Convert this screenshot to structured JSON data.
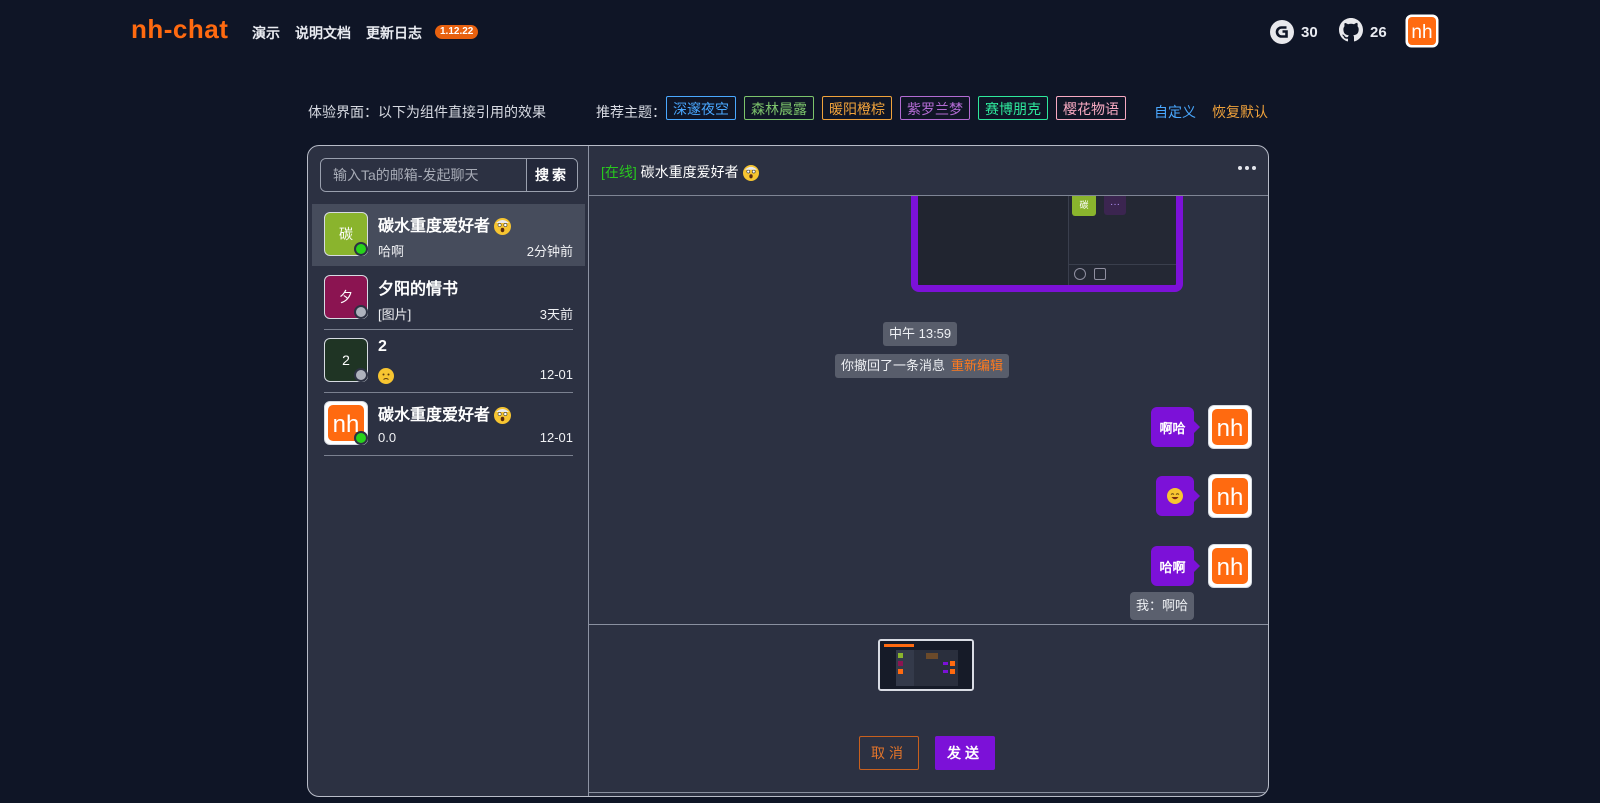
{
  "nav": {
    "brand": "nh-chat",
    "links": [
      "演示",
      "说明文档",
      "更新日志"
    ],
    "version": "1.12.22",
    "gitee_count": "30",
    "github_count": "26",
    "avatar_text": "nh"
  },
  "theme_bar": {
    "intro": "体验界面：以下为组件直接引用的效果",
    "label": "推荐主题：",
    "themes": [
      {
        "name": "深邃夜空",
        "color": "#4aa8ff"
      },
      {
        "name": "森林晨露",
        "color": "#7cc36b"
      },
      {
        "name": "暖阳橙棕",
        "color": "#f0a23b"
      },
      {
        "name": "紫罗兰梦",
        "color": "#b26bd3"
      },
      {
        "name": "赛博朋克",
        "color": "#2ee89c"
      },
      {
        "name": "樱花物语",
        "color": "#f7a9c1"
      }
    ],
    "custom": "自定义",
    "reset": "恢复默认"
  },
  "sidebar": {
    "search_placeholder": "输入Ta的邮箱-发起聊天",
    "search_button": "搜索",
    "conversations": [
      {
        "avatar": "碳",
        "avatar_color": "#8ab42d",
        "name": "碳水重度爱好者",
        "last": "哈啊",
        "time": "2分钟前",
        "online": true
      },
      {
        "avatar": "夕",
        "avatar_color": "#8b1451",
        "name": "夕阳的情书",
        "last": "[图片]",
        "time": "3天前",
        "online": false
      },
      {
        "avatar": "2",
        "avatar_color": "#1f3424",
        "name": "2",
        "last": "",
        "time": "12-01",
        "online": false
      },
      {
        "avatar": "nh",
        "avatar_color": "#ffffff",
        "name": "碳水重度爱好者",
        "last": "0.0",
        "time": "12-01",
        "online": true
      }
    ]
  },
  "chat": {
    "status": "[在线]",
    "title": "碳水重度爱好者",
    "time_pill": "中午 13:59",
    "recall_text": "你撤回了一条消息",
    "recall_action": "重新编辑",
    "thumb_avatar": "碳",
    "thumb_bubble": "···",
    "messages": [
      "啊哈",
      "",
      "哈啊"
    ],
    "quote": "我：啊哈"
  },
  "composer": {
    "cancel": "取消",
    "send": "发送"
  },
  "colors": {
    "brand": "#ff6a10",
    "accent": "#7c11d8",
    "online": "#28d21c",
    "offline": "#aeb2bd",
    "background": "#0f1526",
    "panel": "#2c3142"
  }
}
